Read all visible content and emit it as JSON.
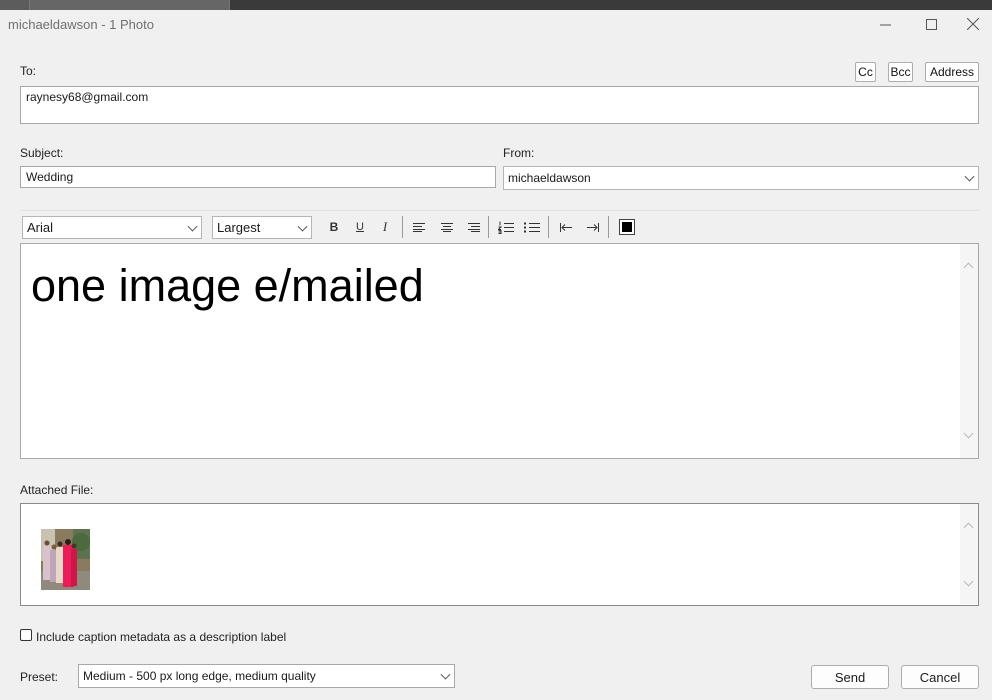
{
  "window": {
    "title": "michaeldawson - 1 Photo"
  },
  "to": {
    "label": "To:",
    "value": "raynesy68@gmail.com",
    "cc_label": "Cc",
    "bcc_label": "Bcc",
    "address_label": "Address"
  },
  "subject": {
    "label": "Subject:",
    "value": "Wedding"
  },
  "from": {
    "label": "From:",
    "value": "michaeldawson"
  },
  "toolbar": {
    "font": "Arial",
    "size": "Largest",
    "bold_label": "B",
    "underline_label": "U",
    "italic_label": "I"
  },
  "body": {
    "text": "one image e/mailed"
  },
  "attachments": {
    "label": "Attached File:"
  },
  "caption": {
    "label": "Include caption metadata as a description label",
    "checked": false
  },
  "preset": {
    "label": "Preset:",
    "value": "Medium - 500 px long edge, medium quality"
  },
  "actions": {
    "send_label": "Send",
    "cancel_label": "Cancel"
  }
}
